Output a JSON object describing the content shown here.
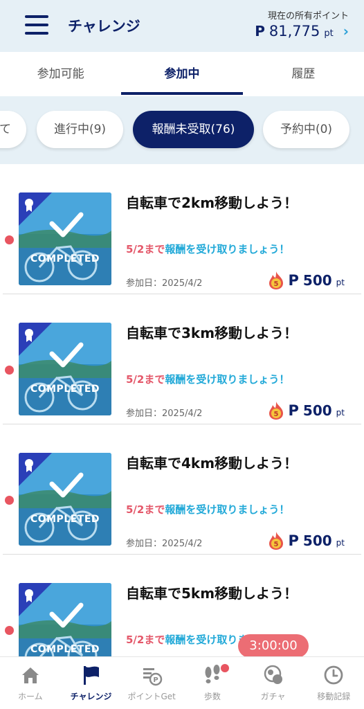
{
  "header": {
    "title": "チャレンジ",
    "points_label": "現在の所有ポイント",
    "points_mark": "P",
    "points_value": "81,775",
    "points_unit": "pt"
  },
  "tabs": [
    {
      "label": "参加可能",
      "active": false
    },
    {
      "label": "参加中",
      "active": true
    },
    {
      "label": "履歴",
      "active": false
    }
  ],
  "chips": [
    {
      "label": "て",
      "active": false
    },
    {
      "label": "進行中(9)",
      "active": false
    },
    {
      "label": "報酬未受取(76)",
      "active": true
    },
    {
      "label": "予約中(0)",
      "active": false
    }
  ],
  "challenges": [
    {
      "title": "自転車で2km移動しよう！",
      "deadline_red": "5/2まで",
      "deadline_blue": "報酬を受け取りましょう！",
      "joined": "参加日：2025/4/2",
      "reward_mark": "P",
      "reward_value": "500",
      "reward_unit": "pt",
      "badge": "COMPLETED",
      "flame_number": "5"
    },
    {
      "title": "自転車で3km移動しよう！",
      "deadline_red": "5/2まで",
      "deadline_blue": "報酬を受け取りましょう！",
      "joined": "参加日：2025/4/2",
      "reward_mark": "P",
      "reward_value": "500",
      "reward_unit": "pt",
      "badge": "COMPLETED",
      "flame_number": "5"
    },
    {
      "title": "自転車で4km移動しよう！",
      "deadline_red": "5/2まで",
      "deadline_blue": "報酬を受け取りましょう！",
      "joined": "参加日：2025/4/2",
      "reward_mark": "P",
      "reward_value": "500",
      "reward_unit": "pt",
      "badge": "COMPLETED",
      "flame_number": "5"
    },
    {
      "title": "自転車で5km移動しよう！",
      "deadline_red": "5/2まで",
      "deadline_blue": "報酬を受け取りましょう！",
      "joined": "",
      "reward_mark": "",
      "reward_value": "",
      "reward_unit": "",
      "badge": "COMPLETED",
      "flame_number": ""
    }
  ],
  "timer": "3:00:00",
  "bottom_nav": [
    {
      "label": "ホーム",
      "icon": "home-icon",
      "active": false
    },
    {
      "label": "チャレンジ",
      "icon": "flag-icon",
      "active": true
    },
    {
      "label": "ポイントGet",
      "icon": "point-get-icon",
      "active": false
    },
    {
      "label": "歩数",
      "icon": "footsteps-icon",
      "active": false
    },
    {
      "label": "ガチャ",
      "icon": "gacha-icon",
      "active": false
    },
    {
      "label": "移動記録",
      "icon": "clock-icon",
      "active": false
    }
  ],
  "colors": {
    "navy": "#0d2168",
    "header_bg": "#e6f0f6",
    "deadline_red": "#e4586a",
    "deadline_blue": "#22a9d8",
    "badge_red": "#e85560"
  }
}
